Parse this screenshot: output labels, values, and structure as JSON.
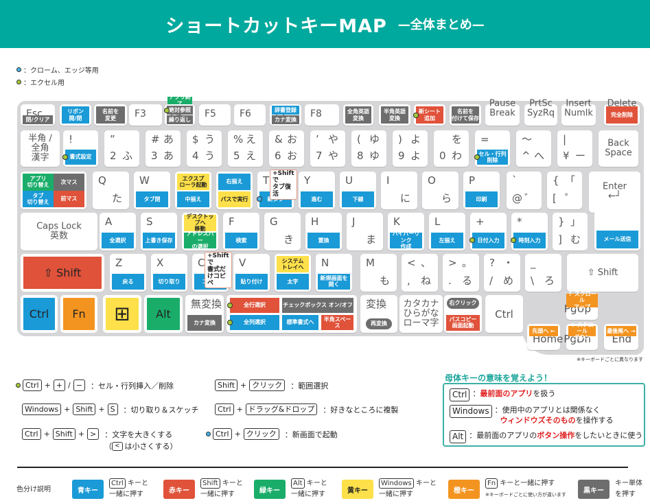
{
  "header": {
    "title": "ショートカットキーMAP",
    "subtitle": "—全体まとめ—"
  },
  "legend": [
    {
      "dot": "chrome",
      "text": "：クローム、エッジ等用"
    },
    {
      "dot": "excel",
      "text": "：エクセル用"
    }
  ],
  "colors": {
    "teal": "#00a99d",
    "blue": "#1a9ad6",
    "red": "#e0523a",
    "green": "#1aad6a",
    "yellow": "#fde04a",
    "orange": "#f39420",
    "gray": "#6d6d6d",
    "chrome_dot": "#45b1e8",
    "excel_dot": "#a5c93a"
  },
  "keys": [
    {
      "id": "esc",
      "l": {
        "tl": "Esc"
      },
      "tags": [
        {
          "t": "閉/クリア",
          "c": "gray",
          "s": "bottom"
        }
      ]
    },
    {
      "id": "f1",
      "l": {
        "tl": "F1"
      },
      "tags": [
        {
          "t": "リボン\n開/閉",
          "c": "blue",
          "s": "full"
        }
      ]
    },
    {
      "id": "f2",
      "l": {
        "tl": "F2"
      },
      "tags": [
        {
          "t": "名前を\n変更",
          "c": "gray",
          "s": "full"
        }
      ]
    },
    {
      "id": "f3",
      "l": {
        "tl": "F3"
      }
    },
    {
      "id": "f4",
      "l": {
        "tl": "F4"
      },
      "tags": [
        {
          "t": "アプリ終了",
          "c": "green",
          "s": "above"
        },
        {
          "t": "絶対参照",
          "c": "gray",
          "s": "top",
          "dot": "excel"
        },
        {
          "t": "繰り返し",
          "c": "gray",
          "s": "bottom"
        }
      ]
    },
    {
      "id": "f5",
      "l": {
        "tl": "F5"
      }
    },
    {
      "id": "f6",
      "l": {
        "tl": "F6"
      }
    },
    {
      "id": "f7",
      "l": {
        "tl": "F7"
      },
      "tags": [
        {
          "t": "辞書登録",
          "c": "blue",
          "s": "top"
        },
        {
          "t": "カナ変換",
          "c": "gray",
          "s": "bottom"
        }
      ]
    },
    {
      "id": "f8",
      "l": {
        "tl": "F8"
      }
    },
    {
      "id": "f9",
      "l": {
        "tl": "F9"
      },
      "tags": [
        {
          "t": "全角英語\n変換",
          "c": "gray",
          "s": "full"
        }
      ]
    },
    {
      "id": "f10",
      "l": {
        "tl": "F10"
      },
      "tags": [
        {
          "t": "半角英語\n変換",
          "c": "gray",
          "s": "full"
        }
      ]
    },
    {
      "id": "f11",
      "l": {
        "tl": "F11"
      },
      "tags": [
        {
          "t": "新シート\n追加",
          "c": "red",
          "s": "full",
          "dot": "excel"
        }
      ]
    },
    {
      "id": "f12",
      "l": {
        "tl": "F12"
      },
      "tags": [
        {
          "t": "名前を\n付けて保存",
          "c": "gray",
          "s": "full"
        }
      ]
    },
    {
      "id": "pause",
      "l": {
        "cc": "Pause\nBreak"
      }
    },
    {
      "id": "prtsc",
      "l": {
        "cc": "PrtSc\nSyzRq"
      }
    },
    {
      "id": "insert",
      "l": {
        "cc": "Insert\nNumlk"
      }
    },
    {
      "id": "delete",
      "l": {
        "cc": "Delete\nScrLk"
      },
      "tags": [
        {
          "t": "完全削除",
          "c": "red",
          "s": "full"
        }
      ]
    },
    {
      "id": "hankaku",
      "l": {
        "cc": "半角 /\n全角\n漢字"
      }
    },
    {
      "id": "k1",
      "l": {
        "tl": "!",
        "bl": "1",
        "br": "ぬ"
      },
      "tags": [
        {
          "t": "書式設定",
          "c": "blue",
          "s": "bottom",
          "dot": "excel"
        }
      ]
    },
    {
      "id": "k2",
      "l": {
        "tl": "”",
        "bl": "2",
        "br": "ふ"
      }
    },
    {
      "id": "k3",
      "l": {
        "tl": "#",
        "tr": "あ",
        "bl": "3",
        "br": "あ"
      }
    },
    {
      "id": "k4",
      "l": {
        "tl": "$",
        "tr": "う",
        "bl": "4",
        "br": "う"
      }
    },
    {
      "id": "k5",
      "l": {
        "tl": "%",
        "tr": "え",
        "bl": "5",
        "br": "え"
      }
    },
    {
      "id": "k6",
      "l": {
        "tl": "&",
        "tr": "お",
        "bl": "6",
        "br": "お"
      }
    },
    {
      "id": "k7",
      "l": {
        "tl": "’",
        "tr": "や",
        "bl": "7",
        "br": "や"
      }
    },
    {
      "id": "k8",
      "l": {
        "tl": "(",
        "tr": "ゆ",
        "bl": "8",
        "br": "ゆ"
      }
    },
    {
      "id": "k9",
      "l": {
        "tl": ")",
        "tr": "よ",
        "bl": "9",
        "br": "よ"
      }
    },
    {
      "id": "k0",
      "l": {
        "tr": "を",
        "bl": "0",
        "br": "わ"
      }
    },
    {
      "id": "minus",
      "l": {
        "tl": "=",
        "bl": "-",
        "br": "ほ"
      },
      "tags": [
        {
          "t": "セル・行列\n削除",
          "c": "blue",
          "s": "bottom",
          "dot": "excel"
        }
      ]
    },
    {
      "id": "caret",
      "l": {
        "tl": "～",
        "bl": "^",
        "br": "へ"
      }
    },
    {
      "id": "yen",
      "l": {
        "tl": "|",
        "bl": "¥",
        "br": "ー"
      }
    },
    {
      "id": "backspace",
      "l": {
        "cc": "Back\nSpace"
      }
    },
    {
      "id": "tab",
      "l": {
        "tl": "Tab"
      },
      "tags": [
        {
          "t": "アプリ\n切り替え",
          "c": "green",
          "s": "q1"
        },
        {
          "t": "次マス",
          "c": "gray",
          "s": "q2"
        },
        {
          "t": "タブ\n切り替え",
          "c": "blue",
          "s": "q3"
        },
        {
          "t": "前マス",
          "c": "red",
          "s": "q4"
        }
      ]
    },
    {
      "id": "q",
      "l": {
        "tl": "Q",
        "br": "た"
      }
    },
    {
      "id": "w",
      "l": {
        "tl": "W",
        "br": "て"
      },
      "tags": [
        {
          "t": "タブ閉",
          "c": "blue",
          "s": "bottom"
        }
      ]
    },
    {
      "id": "e",
      "l": {
        "tl": "E",
        "br": "い"
      },
      "tags": [
        {
          "t": "エクスプ\nローラ起動",
          "c": "yellow",
          "s": "top"
        },
        {
          "t": "中揃え",
          "c": "blue",
          "s": "bottom"
        }
      ]
    },
    {
      "id": "r",
      "l": {
        "tl": "R",
        "br": "す"
      },
      "tags": [
        {
          "t": "右揃え",
          "c": "blue",
          "s": "top"
        },
        {
          "t": "パスで実行",
          "c": "yellow",
          "s": "bottom"
        }
      ]
    },
    {
      "id": "t",
      "l": {
        "tl": "T",
        "br": "か"
      },
      "tags": [
        {
          "t": "新タブ",
          "c": "blue",
          "s": "bottom",
          "dot": "chrome"
        }
      ],
      "callout": "+Shiftで\nタブ復活"
    },
    {
      "id": "y",
      "l": {
        "tl": "Y",
        "br": "ん"
      },
      "tags": [
        {
          "t": "進む",
          "c": "blue",
          "s": "bottom"
        }
      ]
    },
    {
      "id": "u",
      "l": {
        "tl": "U",
        "br": "な"
      },
      "tags": [
        {
          "t": "下線",
          "c": "blue",
          "s": "bottom"
        }
      ]
    },
    {
      "id": "i",
      "l": {
        "tl": "I",
        "br": "に"
      }
    },
    {
      "id": "o",
      "l": {
        "tl": "O",
        "br": "ら"
      }
    },
    {
      "id": "p",
      "l": {
        "tl": "P",
        "br": "せ"
      },
      "tags": [
        {
          "t": "印刷",
          "c": "blue",
          "s": "bottom"
        }
      ]
    },
    {
      "id": "at",
      "l": {
        "tl": "`",
        "bl": "@",
        "br": "゛"
      }
    },
    {
      "id": "lbracket",
      "l": {
        "tl": "{",
        "tr": "「",
        "bl": "[",
        "br": "゜"
      }
    },
    {
      "id": "enter",
      "l": {
        "cc": "Enter\n←┘"
      }
    },
    {
      "id": "caps",
      "l": {
        "cc": "Caps Lock\n英数"
      }
    },
    {
      "id": "a",
      "l": {
        "tl": "A",
        "br": "ち"
      },
      "tags": [
        {
          "t": "全選択",
          "c": "blue",
          "s": "bottom"
        }
      ]
    },
    {
      "id": "s",
      "l": {
        "tl": "S",
        "br": "と"
      },
      "tags": [
        {
          "t": "上書き保存",
          "c": "blue",
          "s": "bottom"
        }
      ]
    },
    {
      "id": "d",
      "l": {
        "tl": "D",
        "br": "し"
      },
      "tags": [
        {
          "t": "デスクトップへ\n移動",
          "c": "yellow",
          "s": "top"
        },
        {
          "t": "アドレスバー\nの選択",
          "c": "green",
          "s": "bottom"
        }
      ]
    },
    {
      "id": "f",
      "l": {
        "tl": "F",
        "br": "は"
      },
      "tags": [
        {
          "t": "検索",
          "c": "blue",
          "s": "bottom"
        }
      ]
    },
    {
      "id": "g",
      "l": {
        "tl": "G",
        "br": "き"
      }
    },
    {
      "id": "h",
      "l": {
        "tl": "H",
        "br": "く"
      },
      "tags": [
        {
          "t": "置換",
          "c": "blue",
          "s": "bottom"
        }
      ]
    },
    {
      "id": "j",
      "l": {
        "tl": "J",
        "br": "ま"
      }
    },
    {
      "id": "k",
      "l": {
        "tl": "K",
        "br": "の"
      },
      "tags": [
        {
          "t": "ハイパーリンク\n作成",
          "c": "blue",
          "s": "bottom"
        }
      ]
    },
    {
      "id": "l",
      "l": {
        "tl": "L",
        "br": "り"
      },
      "tags": [
        {
          "t": "左揃え",
          "c": "blue",
          "s": "bottom"
        }
      ]
    },
    {
      "id": "semicolon",
      "l": {
        "tl": "+",
        "bl": ";",
        "br": "れ"
      },
      "tags": [
        {
          "t": "日付入力",
          "c": "blue",
          "s": "bottom",
          "dot": "excel"
        }
      ]
    },
    {
      "id": "colon",
      "l": {
        "tl": "*",
        "bl": ":",
        "br": "け"
      },
      "tags": [
        {
          "t": "時刻入力",
          "c": "blue",
          "s": "bottom",
          "dot": "excel"
        }
      ]
    },
    {
      "id": "rbracket",
      "l": {
        "tl": "}",
        "tr": "」",
        "bl": "]",
        "br": "む"
      }
    },
    {
      "id": "enter2",
      "tags": [
        {
          "t": "メール送信",
          "c": "blue",
          "s": "bottom"
        }
      ]
    },
    {
      "id": "lshift",
      "fill": "red",
      "l": {
        "cc": "⇧ Shift"
      }
    },
    {
      "id": "z",
      "l": {
        "tl": "Z",
        "br": "つ"
      },
      "tags": [
        {
          "t": "戻る",
          "c": "blue",
          "s": "bottom"
        }
      ]
    },
    {
      "id": "x",
      "l": {
        "tl": "X",
        "br": "さ"
      },
      "tags": [
        {
          "t": "切り取り",
          "c": "blue",
          "s": "bottom"
        }
      ]
    },
    {
      "id": "c",
      "l": {
        "tl": "C",
        "br": "そ"
      },
      "tags": [
        {
          "t": "コピー",
          "c": "blue",
          "s": "bottom"
        }
      ],
      "callout": "+Shiftで\n書式だけコピペ"
    },
    {
      "id": "v",
      "l": {
        "tl": "V",
        "br": "ひ"
      },
      "tags": [
        {
          "t": "貼り付け",
          "c": "blue",
          "s": "bottom"
        }
      ]
    },
    {
      "id": "b",
      "l": {
        "tl": "B",
        "br": "こ"
      },
      "tags": [
        {
          "t": "システム\nトレイへ",
          "c": "yellow",
          "s": "top"
        },
        {
          "t": "太字",
          "c": "blue",
          "s": "bottom"
        }
      ]
    },
    {
      "id": "n",
      "l": {
        "tl": "N",
        "br": "み"
      },
      "tags": [
        {
          "t": "新規画面を\n開く",
          "c": "blue",
          "s": "bottom"
        }
      ]
    },
    {
      "id": "m",
      "l": {
        "tl": "M",
        "br": "も"
      }
    },
    {
      "id": "comma",
      "l": {
        "tl": "<",
        "tr": "、",
        "bl": ",",
        "br": "ね"
      }
    },
    {
      "id": "period",
      "l": {
        "tl": ">",
        "tr": "。",
        "bl": ".",
        "br": "る"
      }
    },
    {
      "id": "slash",
      "l": {
        "tl": "?",
        "tr": "・",
        "bl": "/",
        "br": "め"
      }
    },
    {
      "id": "backslash",
      "l": {
        "tl": "_",
        "bl": "\\",
        "br": "ろ"
      }
    },
    {
      "id": "rshift",
      "l": {
        "cc": "⇧ Shift"
      }
    },
    {
      "id": "lctrl",
      "fill": "blue",
      "l": {
        "cc": "Ctrl"
      }
    },
    {
      "id": "fn",
      "fill": "orange",
      "l": {
        "cc": "Fn"
      }
    },
    {
      "id": "win",
      "fill": "yellow",
      "l": {
        "cc": "⊞"
      }
    },
    {
      "id": "alt",
      "fill": "green",
      "l": {
        "cc": "Alt"
      }
    },
    {
      "id": "muhenkan",
      "l": {
        "tl": "無変換"
      },
      "tags": [
        {
          "t": "カナ変換",
          "c": "gray",
          "s": "bottom"
        }
      ]
    },
    {
      "id": "space",
      "tags": [
        {
          "t": "全行選択",
          "c": "red",
          "s": "s1",
          "dot": "excel"
        },
        {
          "t": "チェックボックス オン/オフ",
          "c": "gray",
          "s": "s2"
        },
        {
          "t": "全列選択",
          "c": "blue",
          "s": "s3",
          "dot": "excel"
        },
        {
          "t": "標準書式へ",
          "c": "blue",
          "s": "s4"
        },
        {
          "t": "半角スペース",
          "c": "red",
          "s": "s5"
        }
      ]
    },
    {
      "id": "henkan",
      "l": {
        "tl": "変換"
      },
      "tags": [
        {
          "t": "再変換",
          "c": "gray",
          "s": "pillbottom"
        }
      ]
    },
    {
      "id": "katakana",
      "l": {
        "cc": "カタカナ\nひらがな\nローマ字"
      }
    },
    {
      "id": "app",
      "tags": [
        {
          "t": "右クリック",
          "c": "gray",
          "s": "pilltop"
        },
        {
          "t": "パスコピー\n画面起動",
          "c": "red",
          "s": "bottom"
        }
      ]
    },
    {
      "id": "rctrl",
      "l": {
        "cc": "Ctrl"
      }
    },
    {
      "id": "pgup",
      "l": {
        "br": "PgUp"
      },
      "tags": [
        {
          "t": "↑ スクロール\nアップ",
          "c": "orange",
          "s": "above2"
        }
      ]
    },
    {
      "id": "home",
      "l": {
        "bl": "Home"
      },
      "tags": [
        {
          "t": "先頭へ ←",
          "c": "orange",
          "s": "top"
        }
      ]
    },
    {
      "id": "pgdn",
      "l": {
        "br": "PgDn"
      },
      "tags": [
        {
          "t": "↓ スクロール\nダウン",
          "c": "orange",
          "s": "top"
        }
      ]
    },
    {
      "id": "end",
      "l": {
        "br": "End"
      },
      "tags": [
        {
          "t": "最後尾へ →",
          "c": "orange",
          "s": "top"
        }
      ]
    }
  ],
  "keyboard_note": "※キーボードごとに異なります",
  "shortcuts": [
    {
      "dot": "excel",
      "parts": [
        "Ctrl",
        "+",
        "+",
        "/",
        "−"
      ],
      "desc": "：セル・行列挿入／削除"
    },
    {
      "parts": [
        "Windows",
        "+",
        "Shift",
        "+",
        "S"
      ],
      "desc": "：切り取り＆スケッチ"
    },
    {
      "parts": [
        "Ctrl",
        "+",
        "Shift",
        "+",
        ">"
      ],
      "desc": "：文字を大きくする",
      "note_pre": "（",
      "note_key": "<",
      "note": "は小さくする）"
    },
    {
      "parts": [
        "Shift",
        "+",
        "クリック"
      ],
      "desc": "：範囲選択"
    },
    {
      "parts": [
        "Ctrl",
        "+",
        "ドラッグ&ドロップ"
      ],
      "desc": "：好きなところに複製"
    },
    {
      "dot": "chrome",
      "parts": [
        "Ctrl",
        "+",
        "クリック"
      ],
      "desc": "：新画面で起動"
    }
  ],
  "modifier_box": {
    "title": "母体キーの意味を覚えよう！",
    "rows": [
      {
        "key": "Ctrl",
        "lines": [
          [
            {
              "t": "："
            },
            {
              "t": "最前面のアプリ",
              "r": true
            },
            {
              "t": "を扱う"
            }
          ]
        ]
      },
      {
        "key": "Windows",
        "lines": [
          [
            {
              "t": "：使用中のアプリとは関係なく"
            }
          ],
          [
            {
              "t": "ウィンドウズそのもの",
              "r": true
            },
            {
              "t": "を操作する"
            }
          ]
        ]
      },
      {
        "key": "Alt",
        "lines": [
          [
            {
              "t": "：最前面のアプリの"
            },
            {
              "t": "ボタン操作",
              "r": true
            },
            {
              "t": "をしたいときに使う"
            }
          ]
        ]
      }
    ]
  },
  "color_legend": {
    "label": "色分け説明",
    "items": [
      {
        "name": "青キー",
        "color": "blue",
        "key": "Ctrl",
        "text1": "キーと",
        "text2": "一緒に押す"
      },
      {
        "name": "赤キー",
        "color": "red",
        "key": "Shift",
        "text1": "キーと",
        "text2": "一緒に押す"
      },
      {
        "name": "緑キー",
        "color": "green",
        "key": "Alt",
        "text1": "キーと",
        "text2": "一緒に押す"
      },
      {
        "name": "黄キー",
        "color": "yellow",
        "key": "Windows",
        "text1": "キーと",
        "text2": "一緒に押す"
      },
      {
        "name": "橙キー",
        "color": "orange",
        "key": "Fn",
        "text1": "キーと一緒に押す",
        "text2": "※キーボードごとに使い方が違います"
      },
      {
        "name": "黒キー",
        "color": "gray",
        "text1": "キー単体",
        "text2": "を押す"
      }
    ]
  }
}
